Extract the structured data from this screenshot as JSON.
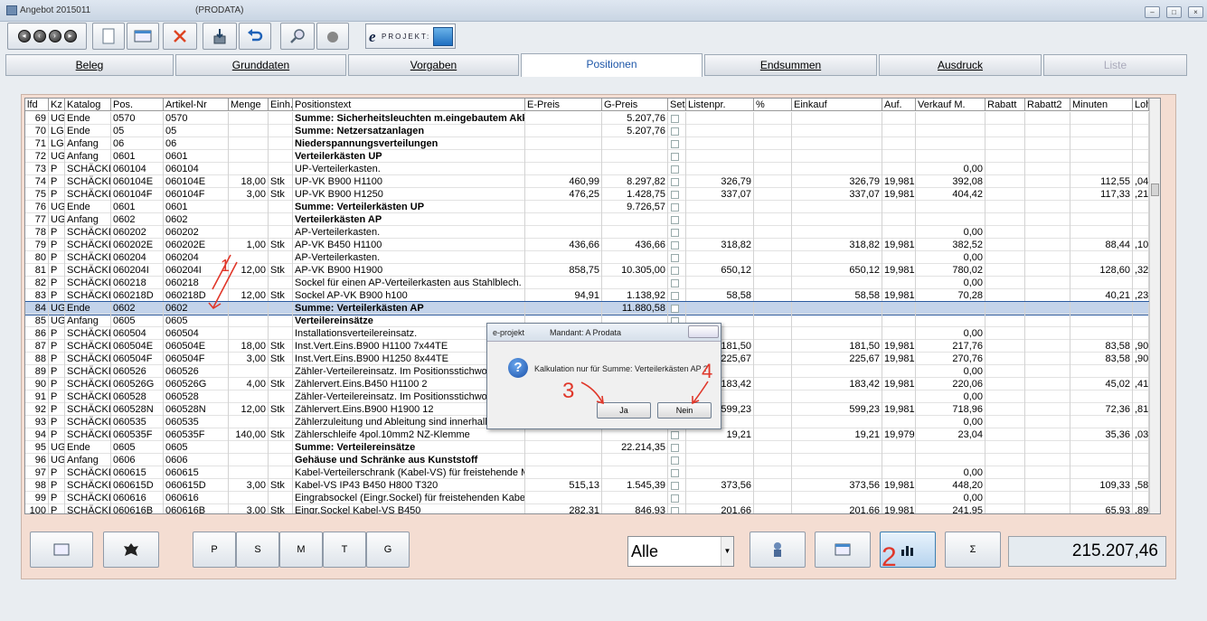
{
  "window": {
    "title": "Angebot 2015011",
    "subtitle": "(PRODATA)"
  },
  "toolbar": {
    "eprojekt_e": "e",
    "eprojekt_label": "PROJEKT:"
  },
  "tabs": [
    {
      "label": "Beleg"
    },
    {
      "label": "Grunddaten"
    },
    {
      "label": "Vorgaben"
    },
    {
      "label": "Positionen"
    },
    {
      "label": "Endsummen"
    },
    {
      "label": "Ausdruck"
    },
    {
      "label": "Liste"
    }
  ],
  "columns": [
    "lfd",
    "Kz",
    "Katalog",
    "Pos.",
    "Artikel-Nr",
    "Menge",
    "Einh.",
    "Positionstext",
    "E-Preis",
    "G-Preis",
    "Set",
    "Listenpr.",
    "%",
    "Einkauf",
    "Auf.",
    "Verkauf M.",
    "Rabatt",
    "Rabatt2",
    "Minuten",
    "Loh"
  ],
  "rows": [
    {
      "lfd": "69",
      "kz": "UG",
      "kat": "Ende",
      "pos": "0570",
      "art": "0570",
      "menge": "",
      "einh": "",
      "text": "Summe: Sicherheitsleuchten m.eingebautem Akku-S",
      "bold": true,
      "ep": "",
      "gp": "5.207,76",
      "lp": "",
      "ek": "",
      "auf": "",
      "vk": "",
      "min": "",
      "loh": ""
    },
    {
      "lfd": "70",
      "kz": "LG",
      "kat": "Ende",
      "pos": "05",
      "art": "05",
      "menge": "",
      "einh": "",
      "text": "Summe: Netzersatzanlagen",
      "bold": true,
      "ep": "",
      "gp": "5.207,76",
      "lp": "",
      "ek": "",
      "auf": "",
      "vk": "",
      "min": "",
      "loh": ""
    },
    {
      "lfd": "71",
      "kz": "LG",
      "kat": "Anfang",
      "pos": "06",
      "art": "06",
      "menge": "",
      "einh": "",
      "text": "Niederspannungsverteilungen",
      "bold": true,
      "ep": "",
      "gp": "",
      "lp": "",
      "ek": "",
      "auf": "",
      "vk": "",
      "min": "",
      "loh": ""
    },
    {
      "lfd": "72",
      "kz": "UG",
      "kat": "Anfang",
      "pos": "0601",
      "art": "0601",
      "menge": "",
      "einh": "",
      "text": "Verteilerkästen UP",
      "bold": true,
      "ep": "",
      "gp": "",
      "lp": "",
      "ek": "",
      "auf": "",
      "vk": "",
      "min": "",
      "loh": ""
    },
    {
      "lfd": "73",
      "kz": "P",
      "kat": "SCHÄCKE",
      "pos": "060104",
      "art": "060104",
      "menge": "",
      "einh": "",
      "text": "UP-Verteilerkasten.",
      "bold": false,
      "ep": "",
      "gp": "",
      "lp": "",
      "ek": "",
      "auf": "",
      "vk": "0,00",
      "min": "",
      "loh": ""
    },
    {
      "lfd": "74",
      "kz": "P",
      "kat": "SCHÄCKE",
      "pos": "060104E",
      "art": "060104E",
      "menge": "18,00",
      "einh": "Stk",
      "text": "UP-VK  B900 H1100",
      "bold": false,
      "ep": "460,99",
      "gp": "8.297,82",
      "lp": "326,79",
      "ek": "326,79",
      "auf": "19,981",
      "vk": "392,08",
      "min": "112,55",
      "loh": ",04"
    },
    {
      "lfd": "75",
      "kz": "P",
      "kat": "SCHÄCKE",
      "pos": "060104F",
      "art": "060104F",
      "menge": "3,00",
      "einh": "Stk",
      "text": "UP-VK  B900 H1250",
      "bold": false,
      "ep": "476,25",
      "gp": "1.428,75",
      "lp": "337,07",
      "ek": "337,07",
      "auf": "19,981",
      "vk": "404,42",
      "min": "117,33",
      "loh": ",21"
    },
    {
      "lfd": "76",
      "kz": "UG",
      "kat": "Ende",
      "pos": "0601",
      "art": "0601",
      "menge": "",
      "einh": "",
      "text": "Summe: Verteilerkästen UP",
      "bold": true,
      "ep": "",
      "gp": "9.726,57",
      "lp": "",
      "ek": "",
      "auf": "",
      "vk": "",
      "min": "",
      "loh": ""
    },
    {
      "lfd": "77",
      "kz": "UG",
      "kat": "Anfang",
      "pos": "0602",
      "art": "0602",
      "menge": "",
      "einh": "",
      "text": "Verteilerkästen AP",
      "bold": true,
      "ep": "",
      "gp": "",
      "lp": "",
      "ek": "",
      "auf": "",
      "vk": "",
      "min": "",
      "loh": ""
    },
    {
      "lfd": "78",
      "kz": "P",
      "kat": "SCHÄCKE",
      "pos": "060202",
      "art": "060202",
      "menge": "",
      "einh": "",
      "text": "AP-Verteilerkasten.",
      "bold": false,
      "ep": "",
      "gp": "",
      "lp": "",
      "ek": "",
      "auf": "",
      "vk": "0,00",
      "min": "",
      "loh": ""
    },
    {
      "lfd": "79",
      "kz": "P",
      "kat": "SCHÄCKE",
      "pos": "060202E",
      "art": "060202E",
      "menge": "1,00",
      "einh": "Stk",
      "text": "AP-VK  B450 H1100",
      "bold": false,
      "ep": "436,66",
      "gp": "436,66",
      "lp": "318,82",
      "ek": "318,82",
      "auf": "19,981",
      "vk": "382,52",
      "min": "88,44",
      "loh": ",10"
    },
    {
      "lfd": "80",
      "kz": "P",
      "kat": "SCHÄCKE",
      "pos": "060204",
      "art": "060204",
      "menge": "",
      "einh": "",
      "text": "AP-Verteilerkasten.",
      "bold": false,
      "ep": "",
      "gp": "",
      "lp": "",
      "ek": "",
      "auf": "",
      "vk": "0,00",
      "min": "",
      "loh": ""
    },
    {
      "lfd": "81",
      "kz": "P",
      "kat": "SCHÄCKE",
      "pos": "060204I",
      "art": "060204I",
      "menge": "12,00",
      "einh": "Stk",
      "text": "AP-VK  B900 H1900",
      "bold": false,
      "ep": "858,75",
      "gp": "10.305,00",
      "lp": "650,12",
      "ek": "650,12",
      "auf": "19,981",
      "vk": "780,02",
      "min": "128,60",
      "loh": ",32"
    },
    {
      "lfd": "82",
      "kz": "P",
      "kat": "SCHÄCKE",
      "pos": "060218",
      "art": "060218",
      "menge": "",
      "einh": "",
      "text": "Sockel für einen AP-Verteilerkasten aus Stahlblech. Im P",
      "bold": false,
      "ep": "",
      "gp": "",
      "lp": "",
      "ek": "",
      "auf": "",
      "vk": "0,00",
      "min": "",
      "loh": ""
    },
    {
      "lfd": "83",
      "kz": "P",
      "kat": "SCHÄCKE",
      "pos": "060218D",
      "art": "060218D",
      "menge": "12,00",
      "einh": "Stk",
      "text": "Sockel AP-VK B900 h100",
      "bold": false,
      "ep": "94,91",
      "gp": "1.138,92",
      "lp": "58,58",
      "ek": "58,58",
      "auf": "19,981",
      "vk": "70,28",
      "min": "40,21",
      "loh": ",23"
    },
    {
      "lfd": "84",
      "kz": "UG",
      "kat": "Ende",
      "pos": "0602",
      "art": "0602",
      "menge": "",
      "einh": "",
      "text": "Summe: Verteilerkästen AP",
      "bold": true,
      "ep": "",
      "gp": "11.880,58",
      "lp": "",
      "ek": "",
      "auf": "",
      "vk": "",
      "min": "",
      "loh": "",
      "selected": true
    },
    {
      "lfd": "85",
      "kz": "UG",
      "kat": "Anfang",
      "pos": "0605",
      "art": "0605",
      "menge": "",
      "einh": "",
      "text": "Verteilereinsätze",
      "bold": true,
      "ep": "",
      "gp": "",
      "lp": "",
      "ek": "",
      "auf": "",
      "vk": "",
      "min": "",
      "loh": ""
    },
    {
      "lfd": "86",
      "kz": "P",
      "kat": "SCHÄCKE",
      "pos": "060504",
      "art": "060504",
      "menge": "",
      "einh": "",
      "text": "Installationsverteilereinsatz.",
      "bold": false,
      "ep": "",
      "gp": "",
      "lp": "",
      "ek": "",
      "auf": "",
      "vk": "0,00",
      "min": "",
      "loh": ""
    },
    {
      "lfd": "87",
      "kz": "P",
      "kat": "SCHÄCKE",
      "pos": "060504E",
      "art": "060504E",
      "menge": "18,00",
      "einh": "Stk",
      "text": "Inst.Vert.Eins.B900 H1100 7x44TE",
      "bold": false,
      "ep": "",
      "gp": "",
      "lp": "181,50",
      "ek": "181,50",
      "auf": "19,981",
      "vk": "217,76",
      "min": "83,58",
      "loh": ",90"
    },
    {
      "lfd": "88",
      "kz": "P",
      "kat": "SCHÄCKE",
      "pos": "060504F",
      "art": "060504F",
      "menge": "3,00",
      "einh": "Stk",
      "text": "Inst.Vert.Eins.B900 H1250 8x44TE",
      "bold": false,
      "ep": "",
      "gp": "",
      "lp": "225,67",
      "ek": "225,67",
      "auf": "19,981",
      "vk": "270,76",
      "min": "83,58",
      "loh": ",90"
    },
    {
      "lfd": "89",
      "kz": "P",
      "kat": "SCHÄCKE",
      "pos": "060526",
      "art": "060526",
      "menge": "",
      "einh": "",
      "text": "Zähler-Verteilereinsatz. Im Positionsstichwort ar",
      "bold": false,
      "ep": "",
      "gp": "",
      "lp": "",
      "ek": "",
      "auf": "",
      "vk": "0,00",
      "min": "",
      "loh": ""
    },
    {
      "lfd": "90",
      "kz": "P",
      "kat": "SCHÄCKE",
      "pos": "060526G",
      "art": "060526G",
      "menge": "4,00",
      "einh": "Stk",
      "text": "Zählervert.Eins.B450 H1100 2",
      "bold": false,
      "ep": "",
      "gp": "",
      "lp": "183,42",
      "ek": "183,42",
      "auf": "19,981",
      "vk": "220,06",
      "min": "45,02",
      "loh": ",41"
    },
    {
      "lfd": "91",
      "kz": "P",
      "kat": "SCHÄCKE",
      "pos": "060528",
      "art": "060528",
      "menge": "",
      "einh": "",
      "text": "Zähler-Verteilereinsatz. Im Positionsstichwort ar",
      "bold": false,
      "ep": "",
      "gp": "",
      "lp": "",
      "ek": "",
      "auf": "",
      "vk": "0,00",
      "min": "",
      "loh": ""
    },
    {
      "lfd": "92",
      "kz": "P",
      "kat": "SCHÄCKE",
      "pos": "060528N",
      "art": "060528N",
      "menge": "12,00",
      "einh": "Stk",
      "text": "Zählervert.Eins.B900 H1900 12",
      "bold": false,
      "ep": "",
      "gp": "",
      "lp": "599,23",
      "ek": "599,23",
      "auf": "19,981",
      "vk": "718,96",
      "min": "72,36",
      "loh": ",81"
    },
    {
      "lfd": "93",
      "kz": "P",
      "kat": "SCHÄCKE",
      "pos": "060535",
      "art": "060535",
      "menge": "",
      "einh": "",
      "text": "Zählerzuleitung und Ableitung sind innerhalb des",
      "bold": false,
      "ep": "",
      "gp": "",
      "lp": "",
      "ek": "",
      "auf": "",
      "vk": "0,00",
      "min": "",
      "loh": ""
    },
    {
      "lfd": "94",
      "kz": "P",
      "kat": "SCHÄCKE",
      "pos": "060535F",
      "art": "060535F",
      "menge": "140,00",
      "einh": "Stk",
      "text": "Zählerschleife 4pol.10mm2 NZ-Klemme",
      "bold": false,
      "ep": "",
      "gp": "",
      "lp": "19,21",
      "ek": "19,21",
      "auf": "19,979",
      "vk": "23,04",
      "min": "35,36",
      "loh": ",03"
    },
    {
      "lfd": "95",
      "kz": "UG",
      "kat": "Ende",
      "pos": "0605",
      "art": "0605",
      "menge": "",
      "einh": "",
      "text": "Summe: Verteilereinsätze",
      "bold": true,
      "ep": "",
      "gp": "22.214,35",
      "lp": "",
      "ek": "",
      "auf": "",
      "vk": "",
      "min": "",
      "loh": ""
    },
    {
      "lfd": "96",
      "kz": "UG",
      "kat": "Anfang",
      "pos": "0606",
      "art": "0606",
      "menge": "",
      "einh": "",
      "text": "Gehäuse und Schränke aus Kunststoff",
      "bold": true,
      "ep": "",
      "gp": "",
      "lp": "",
      "ek": "",
      "auf": "",
      "vk": "",
      "min": "",
      "loh": ""
    },
    {
      "lfd": "97",
      "kz": "P",
      "kat": "SCHÄCKE",
      "pos": "060615",
      "art": "060615",
      "menge": "",
      "einh": "",
      "text": "Kabel-Verteilerschrank (Kabel-VS) für freistehende Monta",
      "bold": false,
      "ep": "",
      "gp": "",
      "lp": "",
      "ek": "",
      "auf": "",
      "vk": "0,00",
      "min": "",
      "loh": ""
    },
    {
      "lfd": "98",
      "kz": "P",
      "kat": "SCHÄCKE",
      "pos": "060615D",
      "art": "060615D",
      "menge": "3,00",
      "einh": "Stk",
      "text": "Kabel-VS IP43 B450 H800 T320",
      "bold": false,
      "ep": "515,13",
      "gp": "1.545,39",
      "lp": "373,56",
      "ek": "373,56",
      "auf": "19,981",
      "vk": "448,20",
      "min": "109,33",
      "loh": ",58"
    },
    {
      "lfd": "99",
      "kz": "P",
      "kat": "SCHÄCKE",
      "pos": "060616",
      "art": "060616",
      "menge": "",
      "einh": "",
      "text": "Eingrabsockel (Eingr.Sockel) für freistehenden Kabel-Ver",
      "bold": false,
      "ep": "",
      "gp": "",
      "lp": "",
      "ek": "",
      "auf": "",
      "vk": "0,00",
      "min": "",
      "loh": ""
    },
    {
      "lfd": "100",
      "kz": "P",
      "kat": "SCHÄCKE",
      "pos": "060616B",
      "art": "060616B",
      "menge": "3,00",
      "einh": "Stk",
      "text": "Eingr.Sockel Kabel-VS B450",
      "bold": false,
      "ep": "282,31",
      "gp": "846,93",
      "lp": "201,66",
      "ek": "201,66",
      "auf": "19,981",
      "vk": "241,95",
      "min": "65,93",
      "loh": ",89"
    }
  ],
  "bottom": {
    "p": "P",
    "s": "S",
    "m": "M",
    "t": "T",
    "g": "G",
    "filter": "Alle",
    "sigma": "Σ",
    "total": "215.207,46"
  },
  "dialog": {
    "title": "e-projekt",
    "mandant": "Mandant:  A  Prodata",
    "message": "Kalkulation nur für  Summe: Verteilerkästen AP ?",
    "yes": "Ja",
    "no": "Nein",
    "icon": "question-icon"
  },
  "annotations": {
    "a1": "1",
    "a2": "2",
    "a3": "3",
    "a4": "4"
  }
}
